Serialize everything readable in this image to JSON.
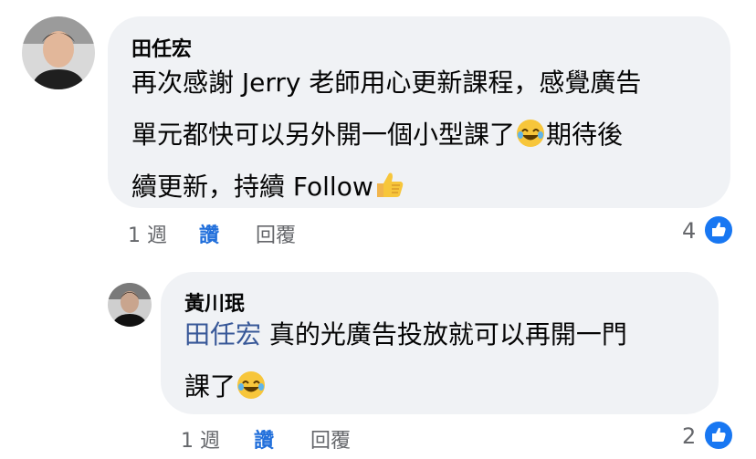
{
  "comments": [
    {
      "author": "田任宏",
      "lines": [
        "再次感謝 Jerry 老師用心更新課程，感覺廣告",
        "單元都快可以另外開一個小型課了",
        "期待後",
        "續更新，持續 Follow"
      ],
      "time": "1 週",
      "like_label": "讚",
      "reply_label": "回覆",
      "reactions": "4",
      "emoji_laugh": "laughing-emoji",
      "emoji_thumb": "thumbs-up-emoji"
    },
    {
      "author": "黃川珉",
      "mention": "田任宏",
      "lines": [
        " 真的光廣告投放就可以再開一門",
        "課了"
      ],
      "time": "1 週",
      "like_label": "讚",
      "reply_label": "回覆",
      "reactions": "2",
      "emoji_laugh": "laughing-emoji"
    }
  ],
  "colors": {
    "bubble": "#f0f2f5",
    "mention": "#385898",
    "like_link": "#216fdb",
    "meta": "#65676b",
    "reaction_badge": "#1877f2"
  }
}
